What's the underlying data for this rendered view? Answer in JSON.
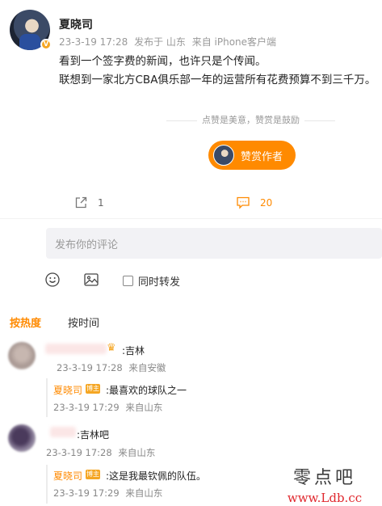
{
  "post": {
    "author": "夏晓司",
    "date": "23-3-19 17:28",
    "location": "发布于 山东",
    "source": "来自 iPhone客户端",
    "lines": [
      "看到一个签字费的新闻，也许只是个传闻。",
      "联想到一家北方CBA俱乐部一年的运营所有花费预算不到三千万。"
    ]
  },
  "reward": {
    "tip": "点赞是美意，赞赏是鼓励",
    "button": "赞赏作者"
  },
  "actions": {
    "share_count": "1",
    "comment_count": "20"
  },
  "composer": {
    "placeholder": "发布你的评论",
    "repost_label": "同时转发"
  },
  "tabs": {
    "hot": "按热度",
    "time": "按时间"
  },
  "comments": [
    {
      "text": ":吉林",
      "date": "23-3-19 17:28",
      "source": "来自安徽",
      "reply": {
        "author": "夏晓司",
        "badge": "博主",
        "text": ":最喜欢的球队之一",
        "date": "23-3-19 17:29",
        "source": "来自山东"
      }
    },
    {
      "text": ":吉林吧",
      "date": "23-3-19 17:28",
      "source": "来自山东",
      "reply": {
        "author": "夏晓司",
        "badge": "博主",
        "text": ":这是我最钦佩的队伍。",
        "date": "23-3-19 17:29",
        "source": "来自山东"
      }
    }
  ],
  "watermark": {
    "line1": "零点吧",
    "line2": "www.Ldb.cc"
  },
  "colors": {
    "accent": "#ff8a00",
    "text": "#222222",
    "muted": "#999999"
  }
}
